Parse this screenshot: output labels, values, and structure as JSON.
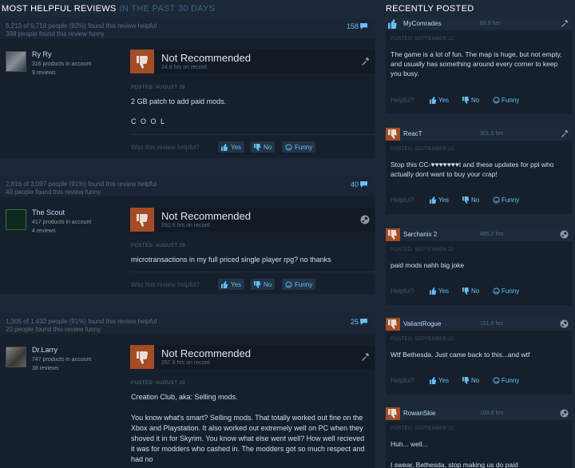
{
  "left_header": {
    "title": "MOST HELPFUL REVIEWS",
    "period": "IN THE PAST 30 DAYS"
  },
  "right_header": {
    "title": "RECENTLY POSTED"
  },
  "vote_labels": {
    "question": "Was this review helpful?",
    "yes": "Yes",
    "no": "No",
    "funny": "Funny"
  },
  "reviews": [
    {
      "helpful_line": "6,213 of 6,718 people (92%) found this review helpful",
      "funny_line": "398 people found this review funny",
      "count": "158",
      "author": "Ry Ry",
      "products": "316 products in account",
      "reviews": "9 reviews",
      "verdict": "Not Recommended",
      "hours": "24.6 hrs on record",
      "posted": "POSTED: AUGUST 29",
      "lines": [
        "2 GB patch to add paid mods.",
        "C O O L"
      ]
    },
    {
      "helpful_line": "2,816 of 3,097 people (91%) found this review helpful",
      "funny_line": "40 people found this review funny",
      "count": "40",
      "author": "The Scout",
      "products": "417 products in account",
      "reviews": "4 reviews",
      "verdict": "Not Recommended",
      "hours": "592.6 hrs on record",
      "posted": "POSTED: AUGUST 29",
      "lines": [
        "microtransactions in my full priced single player rpg? no thanks"
      ]
    },
    {
      "helpful_line": "1,305 of 1,432 people (91%) found this review helpful",
      "funny_line": "20 people found this review funny",
      "count": "25",
      "author": "Dr.Larry",
      "products": "747 products in account",
      "reviews": "38 reviews",
      "verdict": "Not Recommended",
      "hours": "257.6 hrs on record",
      "posted": "POSTED: AUGUST 29",
      "lines": [
        "Creation Club, aka: Selling mods.",
        "You know what's smart? Selling mods. That totally worked out fine on the Xbox and Playstation. It also worked out extremely well on PC when they shoved it in for Skyrim. You know what else went well? How well recieved it was for modders who cashed in. The modders got so much respect and had no"
      ]
    }
  ],
  "recent": [
    {
      "name": "MyComrades",
      "hours": "83.0 hrs",
      "posted": "POSTED: SEPTEMBER 22",
      "text": "The game is a lot of fun. The map is huge, but not empty, and usually has something around every corner to keep you busy.",
      "positive": true
    },
    {
      "name": "ReacT",
      "hours": "301.5 hrs",
      "posted": "POSTED: SEPTEMBER 22",
      "text": "Stop this CC-♥♥♥♥♥♥♥t and these updates for ppl who actually dont want to buy your crap!",
      "positive": false
    },
    {
      "name": "Sarchanix 2",
      "hours": "485.2 hrs",
      "posted": "POSTED: SEPTEMBER 22",
      "text": "paid mods nahh big joke",
      "positive": false
    },
    {
      "name": "ValiantRogue",
      "hours": "151.0 hrs",
      "posted": "POSTED: SEPTEMBER 22",
      "text": "Wtf Bethesda. Just came back to this...and wtf",
      "positive": false
    },
    {
      "name": "RowanSkie",
      "hours": "103.8 hrs",
      "posted": "POSTED: SEPTEMBER 22",
      "text": "Huh... well...",
      "text2": "I swear, Bethesda, stop making us do paid",
      "positive": false
    }
  ],
  "colors": {
    "accent": "#66c0f4",
    "negative": "#a34c25",
    "positive": "#5c7e10",
    "background": "#1b2838"
  }
}
